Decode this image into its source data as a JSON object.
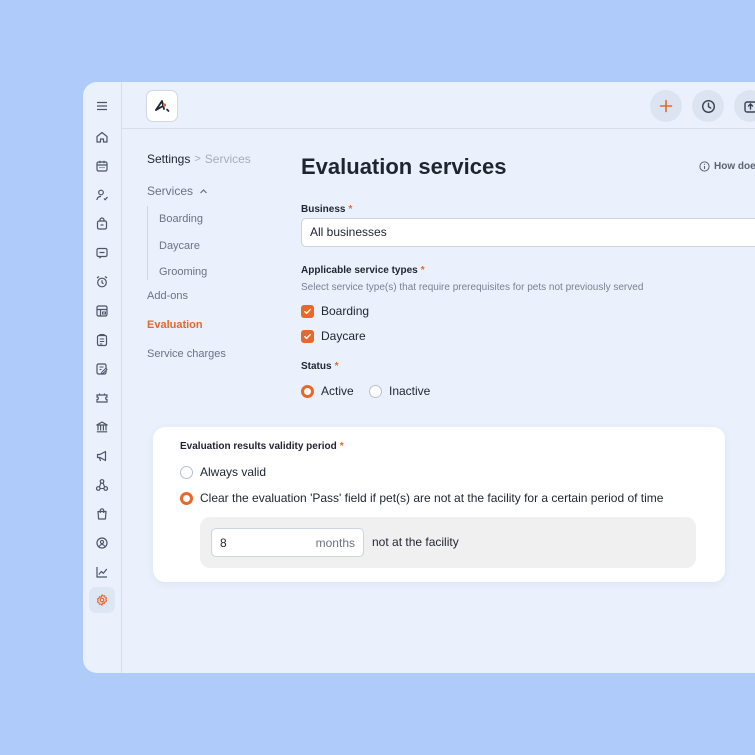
{
  "topbar": {
    "add_icon": "plus-icon",
    "history_icon": "clock-icon",
    "export_icon": "export-icon"
  },
  "breadcrumb": {
    "root": "Settings",
    "separator": ">",
    "current": "Services"
  },
  "subnav": {
    "group_label": "Services",
    "sub_items": [
      "Boarding",
      "Daycare",
      "Grooming"
    ],
    "items": [
      "Add-ons",
      "Evaluation",
      "Service charges"
    ],
    "active_item": "Evaluation"
  },
  "main": {
    "title": "Evaluation services",
    "help_link": "How doe",
    "business": {
      "label": "Business",
      "value": "All businesses"
    },
    "service_types": {
      "label": "Applicable service types",
      "hint": "Select service type(s) that require prerequisites for pets not previously served",
      "options": [
        {
          "label": "Boarding",
          "checked": true
        },
        {
          "label": "Daycare",
          "checked": true
        }
      ]
    },
    "status": {
      "label": "Status",
      "options": [
        {
          "label": "Active",
          "selected": true
        },
        {
          "label": "Inactive",
          "selected": false
        }
      ]
    },
    "validity": {
      "label": "Evaluation results validity period",
      "options": [
        {
          "label": "Always valid",
          "selected": false
        },
        {
          "label": "Clear the evaluation 'Pass' field if pet(s) are not at the facility for a certain period of time",
          "selected": true
        }
      ],
      "duration_value": "8",
      "duration_unit": "months",
      "duration_suffix": "not at the facility"
    }
  },
  "colors": {
    "accent": "#e8672a",
    "background": "#aecbfa",
    "panel": "#eaf1fc"
  }
}
